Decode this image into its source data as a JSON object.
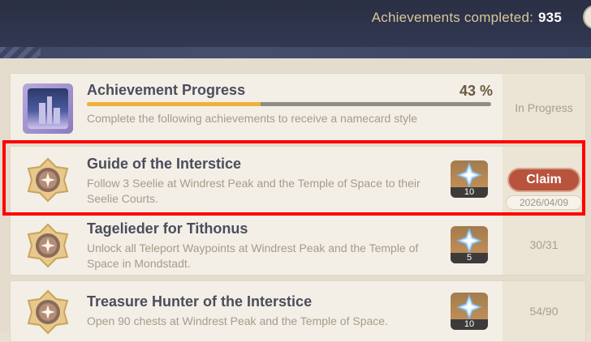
{
  "header": {
    "completed_label": "Achievements completed:",
    "completed_count": "935"
  },
  "progress_card": {
    "title": "Achievement Progress",
    "percent_label": "43 %",
    "percent_value": 43,
    "description": "Complete the following achievements to receive a namecard style",
    "status": "In Progress"
  },
  "achievements": [
    {
      "title": "Guide of the Interstice",
      "description": "Follow 3 Seelie at Windrest Peak and the Temple of Space to their Seelie Courts.",
      "reward_count": "10",
      "claim_label": "Claim",
      "date": "2026/04/09"
    },
    {
      "title": "Tagelieder for Tithonus",
      "description": "Unlock all Teleport Waypoints at Windrest Peak and the Temple of Space in Mondstadt.",
      "reward_count": "5",
      "progress": "30/31"
    },
    {
      "title": "Treasure Hunter of the Interstice",
      "description": "Open 90 chests at Windrest Peak and the Temple of Space.",
      "reward_count": "10",
      "progress": "54/90"
    }
  ],
  "colors": {
    "accent_gold": "#f0b23a",
    "claim_red": "#b8543e",
    "highlight_red": "#ff0000"
  },
  "icons": {
    "medal": "achievement-medal-icon",
    "reward": "primogem-icon",
    "namecard": "namecard-icon"
  }
}
